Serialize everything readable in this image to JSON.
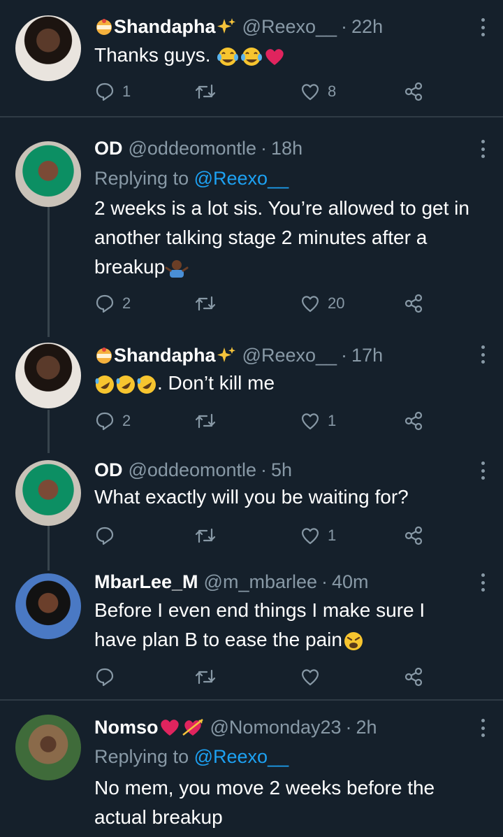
{
  "tweets": [
    {
      "name": "Shandapha",
      "handle": "@Reexo__",
      "time": "22h",
      "text": "Thanks guys. ",
      "replying_to": "",
      "replies": "1",
      "retweets": "",
      "likes": "8"
    },
    {
      "name": "OD",
      "handle": "@oddeomontle",
      "time": "18h",
      "replying_label": "Replying to",
      "replying_to": "@Reexo__",
      "text": "2 weeks is a lot sis. You’re allowed to get in another talking stage 2 minutes after a breakup",
      "replies": "2",
      "retweets": "",
      "likes": "20"
    },
    {
      "name": "Shandapha",
      "handle": "@Reexo__",
      "time": "17h",
      "text": ". Don’t kill me",
      "replying_to": "",
      "replies": "2",
      "retweets": "",
      "likes": "1"
    },
    {
      "name": "OD",
      "handle": "@oddeomontle",
      "time": "5h",
      "text": "What exactly will you be waiting for?",
      "replying_to": "",
      "replies": "",
      "retweets": "",
      "likes": "1"
    },
    {
      "name": "MbarLee_M",
      "handle": "@m_mbarlee",
      "time": "40m",
      "text": "Before I even end things I make sure I have plan B to ease the pain",
      "replying_to": "",
      "replies": "",
      "retweets": "",
      "likes": ""
    },
    {
      "name": "Nomso",
      "handle": "@Nomonday23",
      "time": "2h",
      "replying_label": "Replying to",
      "replying_to": "@Reexo__",
      "text": "No mem, you move 2 weeks before the actual breakup",
      "replies": "",
      "retweets": "",
      "likes": ""
    }
  ],
  "separator": "·",
  "colors": {
    "background": "#15202b",
    "secondary_text": "#8899a6",
    "link": "#1da1f2",
    "divider": "#2f3b45"
  },
  "icons": [
    "reply-icon",
    "retweet-icon",
    "like-icon",
    "share-icon",
    "more-options-icon"
  ]
}
